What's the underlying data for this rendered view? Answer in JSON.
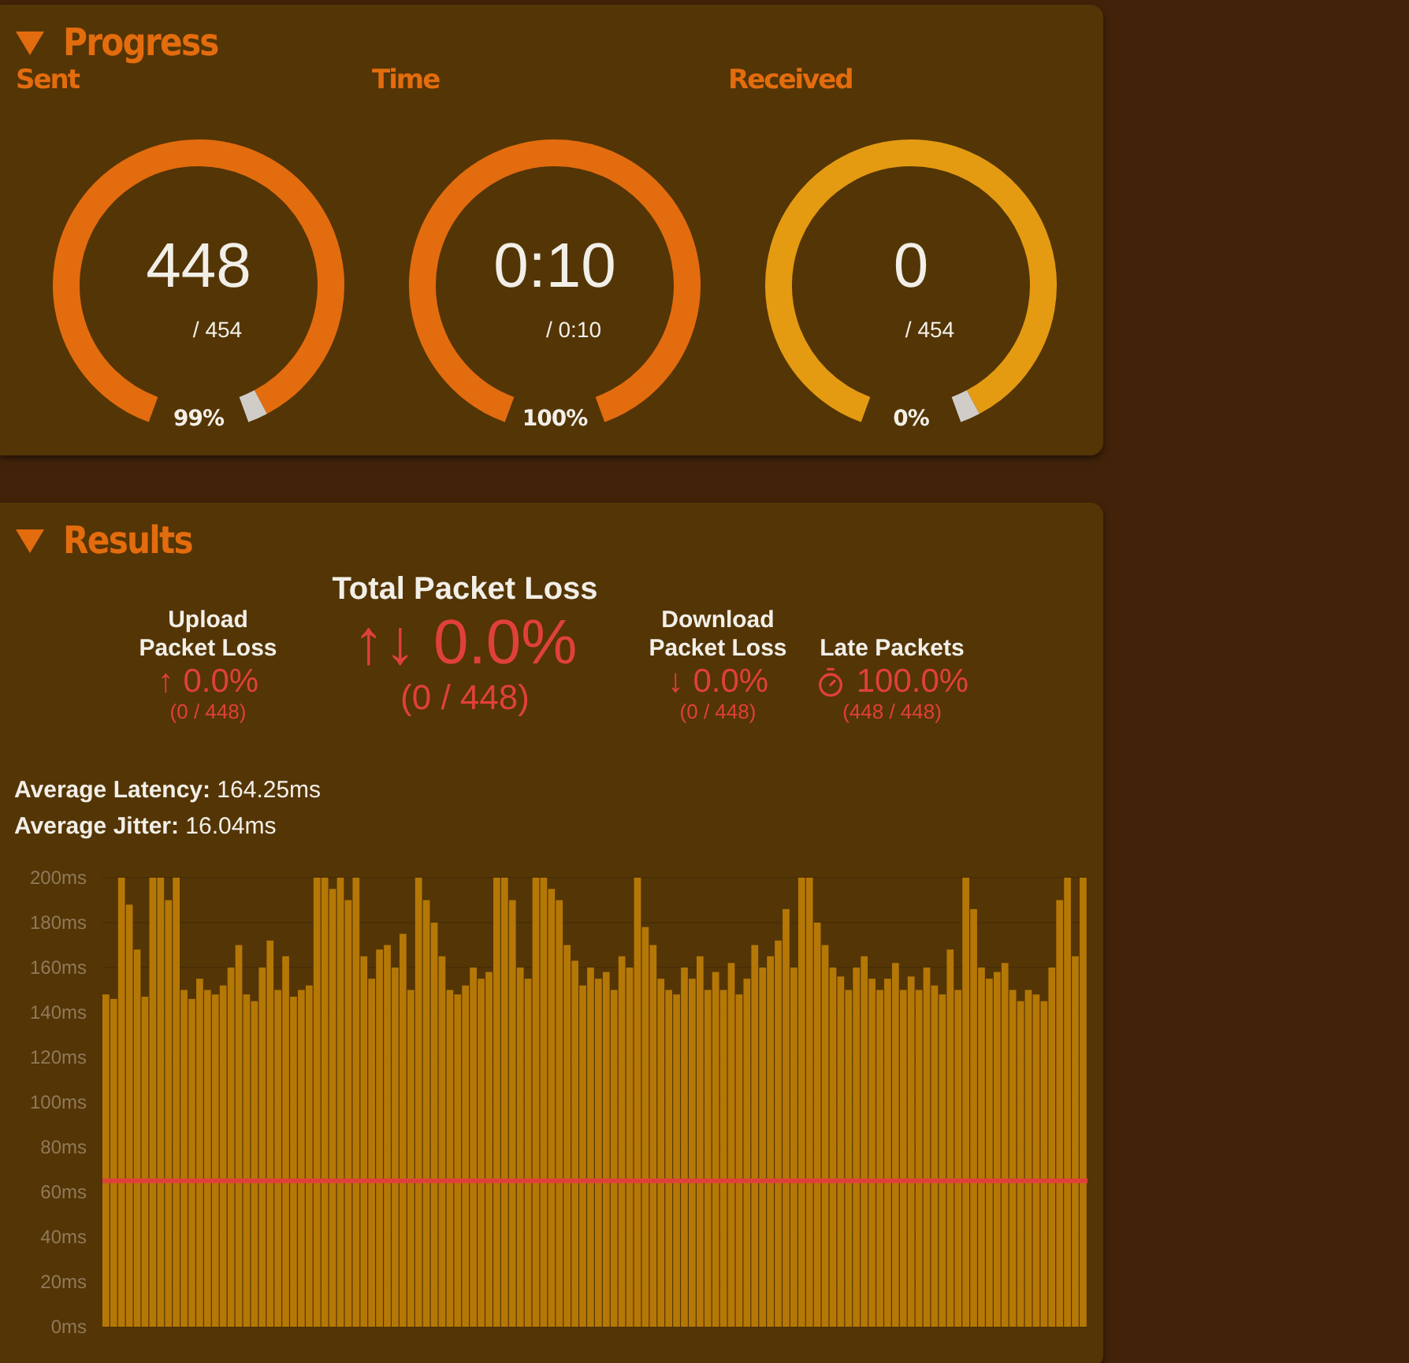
{
  "progress": {
    "title": "Progress",
    "expanded": true,
    "gauges": [
      {
        "label": "Sent",
        "value": "448",
        "total": "/ 454",
        "percent": "99%",
        "complete": false,
        "color": "#e36c0e"
      },
      {
        "label": "Time",
        "value": "0:10",
        "total": "/ 0:10",
        "percent": "100%",
        "complete": true,
        "color": "#e36c0e"
      },
      {
        "label": "Received",
        "value": "0",
        "total": "/ 454",
        "percent": "0%",
        "complete": false,
        "color": "#e49b12"
      }
    ]
  },
  "results": {
    "title": "Results",
    "expanded": true,
    "total": {
      "title": "Total Packet Loss",
      "value": "↑↓ 0.0%",
      "detail": "(0 / 448)"
    },
    "stats": [
      {
        "label": "Upload Packet Loss",
        "value": "↑ 0.0%",
        "detail": "(0 / 448)",
        "kind": "plain"
      },
      {
        "label": "Download Packet Loss",
        "value": "↓ 0.0%",
        "detail": "(0 / 448)",
        "kind": "plain"
      },
      {
        "label": "Late Packets",
        "value": "100.0%",
        "detail": "(448 / 448)",
        "kind": "timed"
      }
    ],
    "averages": [
      {
        "label": "Average Latency:",
        "value": "164.25ms"
      },
      {
        "label": "Average Jitter:",
        "value": "16.04ms"
      }
    ],
    "chart_data": {
      "type": "bar",
      "ylim": [
        0,
        200
      ],
      "grid": true,
      "yticks": [
        {
          "value": 0,
          "label": "0ms"
        },
        {
          "value": 20,
          "label": "20ms"
        },
        {
          "value": 40,
          "label": "40ms"
        },
        {
          "value": 60,
          "label": "60ms"
        },
        {
          "value": 80,
          "label": "80ms"
        },
        {
          "value": 100,
          "label": "100ms"
        },
        {
          "value": 120,
          "label": "120ms"
        },
        {
          "value": 140,
          "label": "140ms"
        },
        {
          "value": 160,
          "label": "160ms"
        },
        {
          "value": 180,
          "label": "180ms"
        },
        {
          "value": 200,
          "label": "200ms"
        }
      ],
      "series": [
        {
          "color": "#b57806",
          "values": [
            148,
            146,
            200,
            188,
            168,
            147,
            200,
            200,
            190,
            200,
            150,
            146,
            155,
            150,
            148,
            152,
            160,
            170,
            148,
            145,
            160,
            172,
            150,
            165,
            147,
            150,
            152,
            200,
            200,
            195,
            200,
            190,
            200,
            165,
            155,
            168,
            170,
            160,
            175,
            150,
            200,
            190,
            180,
            165,
            150,
            148,
            152,
            160,
            155,
            158,
            200,
            200,
            190,
            160,
            155,
            200,
            200,
            195,
            190,
            170,
            163,
            152,
            160,
            155,
            158,
            150,
            165,
            160,
            200,
            178,
            170,
            155,
            150,
            148,
            160,
            155,
            165,
            150,
            158,
            150,
            162,
            148,
            155,
            170,
            160,
            165,
            172,
            186,
            160,
            200,
            200,
            180,
            170,
            160,
            156,
            150,
            160,
            165,
            155,
            150,
            155,
            162,
            150,
            156,
            150,
            160,
            152,
            148,
            168,
            150,
            200,
            186,
            160,
            155,
            158,
            162,
            150,
            145,
            150,
            148,
            145,
            160,
            190,
            200,
            165,
            200
          ]
        }
      ],
      "ref_lines": [
        {
          "axis": "y",
          "value": 65,
          "color": "#e0403a"
        }
      ]
    }
  }
}
